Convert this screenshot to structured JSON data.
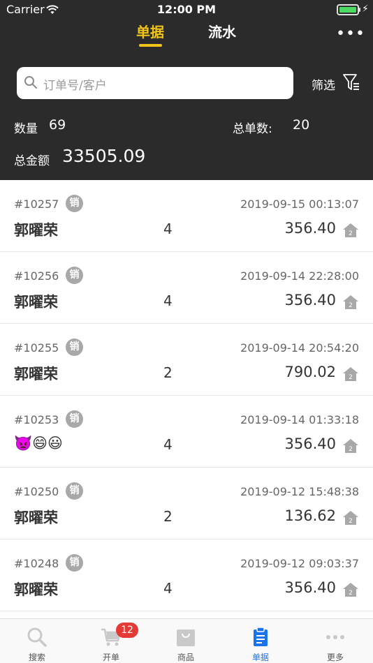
{
  "status_bar": {
    "carrier": "Carrier",
    "time": "12:00 PM"
  },
  "nav": {
    "tab_orders": "单据",
    "tab_flow": "流水",
    "more": "•••"
  },
  "search": {
    "placeholder": "订单号/客户",
    "filter_label": "筛选"
  },
  "summary": {
    "qty_label": "数量",
    "qty_value": "69",
    "count_label": "总单数:",
    "count_value": "20",
    "amount_label": "总金额",
    "amount_value": "33505.09"
  },
  "orders": [
    {
      "no": "#10257",
      "badge": "销",
      "time": "2019-09-15 00:13:07",
      "customer": "郭曜荣",
      "qty": "4",
      "amount": "356.40"
    },
    {
      "no": "#10256",
      "badge": "销",
      "time": "2019-09-14 22:28:00",
      "customer": "郭曜荣",
      "qty": "4",
      "amount": "356.40"
    },
    {
      "no": "#10255",
      "badge": "销",
      "time": "2019-09-14 20:54:20",
      "customer": "郭曜荣",
      "qty": "2",
      "amount": "790.02"
    },
    {
      "no": "#10253",
      "badge": "销",
      "time": "2019-09-14 01:33:18",
      "customer": "👿😄😃",
      "qty": "4",
      "amount": "356.40"
    },
    {
      "no": "#10250",
      "badge": "销",
      "time": "2019-09-12 15:48:38",
      "customer": "郭曜荣",
      "qty": "2",
      "amount": "136.62"
    },
    {
      "no": "#10248",
      "badge": "销",
      "time": "2019-09-12 09:03:37",
      "customer": "郭曜荣",
      "qty": "4",
      "amount": "356.40"
    }
  ],
  "tab_bar": {
    "search": "搜索",
    "open_order": "开单",
    "products": "商品",
    "orders": "单据",
    "more": "更多",
    "cart_badge": "12"
  },
  "colors": {
    "accent": "#f0c419",
    "header_bg": "#2b2b2b",
    "tab_active": "#1a73e8",
    "badge_red": "#e53935"
  }
}
